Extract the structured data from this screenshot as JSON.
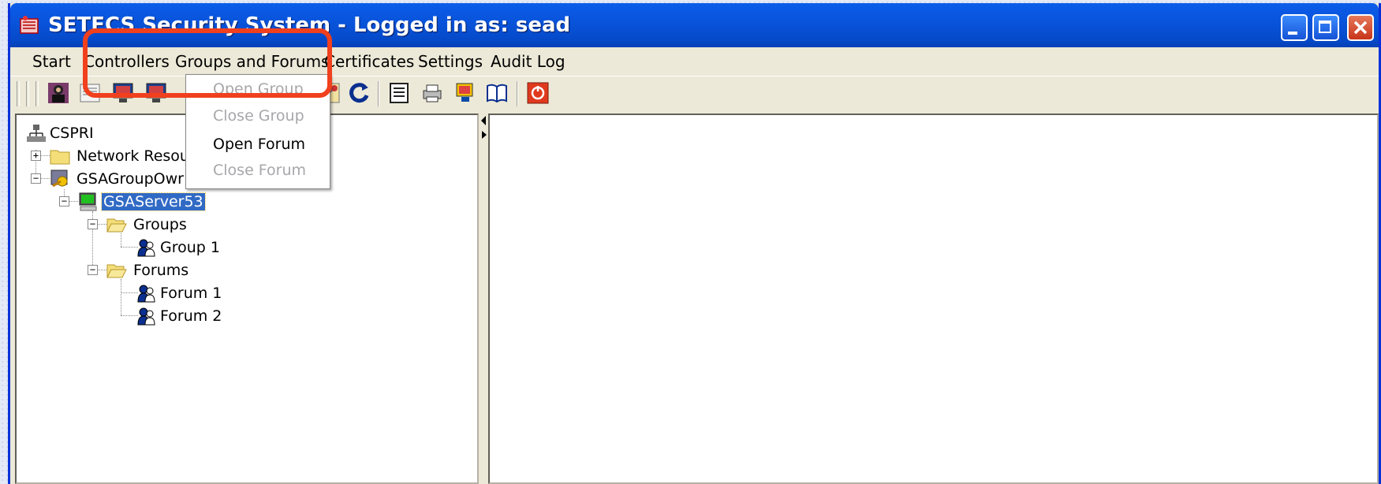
{
  "window": {
    "title": "SETECS Security System - Logged in as: sead"
  },
  "menubar": {
    "items": [
      "Start",
      "Controllers",
      "Groups and Forums",
      "Certificates",
      "Settings",
      "Audit Log"
    ]
  },
  "dropdown": {
    "items": [
      {
        "label": "Open Group",
        "enabled": false
      },
      {
        "label": "Close Group",
        "enabled": false
      },
      {
        "label": "Open Forum",
        "enabled": true
      },
      {
        "label": "Close Forum",
        "enabled": false
      }
    ]
  },
  "tree": {
    "root": "CSPRI",
    "network": "Network Resou",
    "owner": "GSAGroupOwr",
    "server": "GSAServer53",
    "groups": "Groups",
    "group1": "Group 1",
    "forums": "Forums",
    "forum1": "Forum 1",
    "forum2": "Forum 2"
  },
  "toolbar": {
    "icons": [
      "user-icon",
      "certificate-icon",
      "monitor-icon",
      "monitor-icon",
      "hidden-by-menu",
      "hidden-by-menu",
      "tools-icon",
      "refresh-icon",
      "properties-icon",
      "print-icon",
      "monitor-alert-icon",
      "help-book-icon",
      "power-icon"
    ]
  },
  "colors": {
    "titlebar": "#0852d8",
    "highlight": "#f0401e",
    "selection": "#316ac5"
  }
}
